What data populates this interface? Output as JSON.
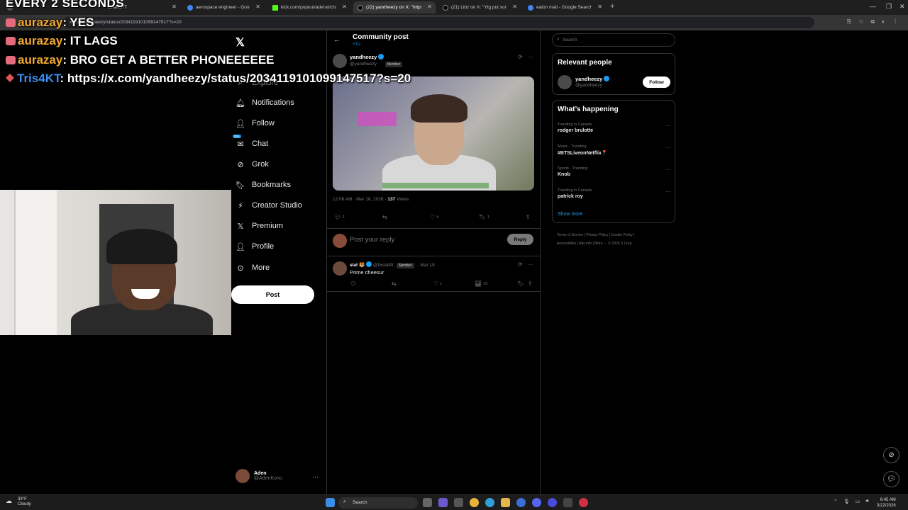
{
  "browser": {
    "tabs": [
      {
        "label": "ChatGPT",
        "active": false
      },
      {
        "label": "aerospace engineer - Google Se",
        "active": false
      },
      {
        "label": "kick.com/popout/adenxt/chat",
        "active": false
      },
      {
        "label": "(22) yandheezy on X: \"https:",
        "active": true
      },
      {
        "label": "(21) Libz on X: \"Ytg put some o",
        "active": false
      },
      {
        "label": "eaton mail - Google Search",
        "active": false
      }
    ],
    "url": "x.com/yandheezy/status/2034119101099147517?s=20"
  },
  "overlay": {
    "title": "EVERY 2 SECONDS",
    "chat": [
      {
        "user": "aurazay",
        "message": "YES"
      },
      {
        "user": "aurazay",
        "message": "IT LAGS"
      },
      {
        "user": "aurazay",
        "message": "BRO GET A BETTER PHONEEEEEE"
      },
      {
        "user": "Tris4KT",
        "message": "https://x.com/yandheezy/status/2034119101099147517?s=20"
      }
    ]
  },
  "nav": {
    "explore": "Explore",
    "items": [
      {
        "label": "Notifications",
        "icon": "bell-icon"
      },
      {
        "label": "Follow",
        "icon": "follow-icon"
      },
      {
        "label": "Chat",
        "icon": "chat-icon",
        "badge": "20+"
      },
      {
        "label": "Grok",
        "icon": "grok-icon"
      },
      {
        "label": "Bookmarks",
        "icon": "bookmark-icon"
      },
      {
        "label": "Creator Studio",
        "icon": "creator-studio-icon"
      },
      {
        "label": "Premium",
        "icon": "x-premium-icon"
      },
      {
        "label": "Profile",
        "icon": "profile-icon"
      },
      {
        "label": "More",
        "icon": "more-icon"
      }
    ],
    "post_button": "Post",
    "account": {
      "name": "Aden",
      "handle": "@AdenKono"
    }
  },
  "main": {
    "header": {
      "title": "Community post",
      "subtitle": "YTG"
    },
    "post": {
      "name": "yandheezy",
      "handle": "@yandheezy",
      "badge": "Member",
      "time": "12:06 AM · Mar 18, 2026 ·",
      "views": "137",
      "views_label": "Views",
      "replies": "1",
      "likes": "4",
      "bookmarks": "1"
    },
    "reply_placeholder": "Post your reply",
    "reply_button": "Reply",
    "comment": {
      "name": "slat 🐯",
      "handle": "@fwslatttt",
      "badge": "Member",
      "date": "· Mar 18",
      "text": "Prime cheesur",
      "likes": "1",
      "views": "15"
    }
  },
  "right": {
    "search_placeholder": "Search",
    "relevant": {
      "title": "Relevant people",
      "name": "yandheezy",
      "handle": "@yandheezy",
      "follow": "Follow"
    },
    "happening": {
      "title": "What’s happening",
      "trends": [
        {
          "context": "Trending in Canada",
          "topic": "rodger brulotte"
        },
        {
          "context": "Music · Trending",
          "topic": "#BTSLiveonNetflix📍"
        },
        {
          "context": "Sports · Trending",
          "topic": "Knob"
        },
        {
          "context": "Trending in Canada",
          "topic": "patrick roy"
        }
      ],
      "show_more": "Show more"
    },
    "footer": [
      "Terms of Service",
      "Privacy Policy",
      "Cookie Policy",
      "Accessibility",
      "Ads info",
      "More ···",
      "© 2026 X Corp."
    ]
  },
  "taskbar": {
    "temp": "33°F",
    "weather": "Cloudy",
    "search": "Search",
    "time": "6:45 AM",
    "date": "3/22/2026"
  }
}
